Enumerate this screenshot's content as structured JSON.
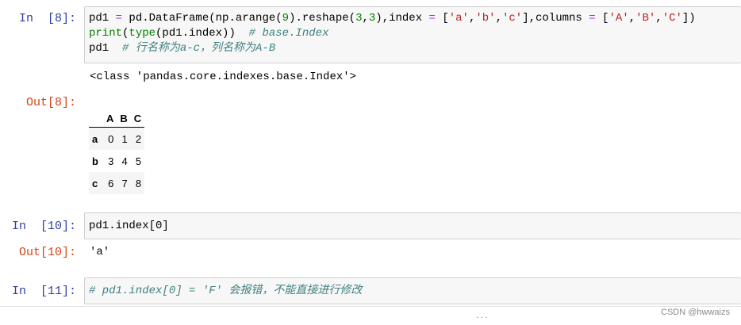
{
  "cells": [
    {
      "in_prompt": "In  [8]:",
      "code_lines": [
        "pd1 = pd.DataFrame(np.arange(9).reshape(3,3),index = ['a','b','c'],columns = ['A','B','C'])",
        "print(type(pd1.index))  # base.Index",
        "pd1  # 行名称为a-c，列名称为A-B"
      ],
      "stdout": "<class 'pandas.core.indexes.base.Index'>",
      "out_prompt": "Out[8]:",
      "table": {
        "columns": [
          "",
          "A",
          "B",
          "C"
        ],
        "rows": [
          {
            "index": "a",
            "values": [
              "0",
              "1",
              "2"
            ]
          },
          {
            "index": "b",
            "values": [
              "3",
              "4",
              "5"
            ]
          },
          {
            "index": "c",
            "values": [
              "6",
              "7",
              "8"
            ]
          }
        ]
      }
    },
    {
      "in_prompt": "In  [10]:",
      "code": "pd1.index[0]",
      "out_prompt": "Out[10]:",
      "output": "'a'"
    },
    {
      "in_prompt": "In  [11]:",
      "code": "# pd1.index[0] = 'F' 会报错，不能直接进行修改"
    }
  ],
  "footer": {
    "dots": "...",
    "watermark": "CSDN @hwwaizs"
  },
  "colors": {
    "in_prompt": "#303F9F",
    "out_prompt": "#D84315",
    "input_bg": "#F7F7F7",
    "comment": "#408080",
    "string": "#BA2121"
  }
}
